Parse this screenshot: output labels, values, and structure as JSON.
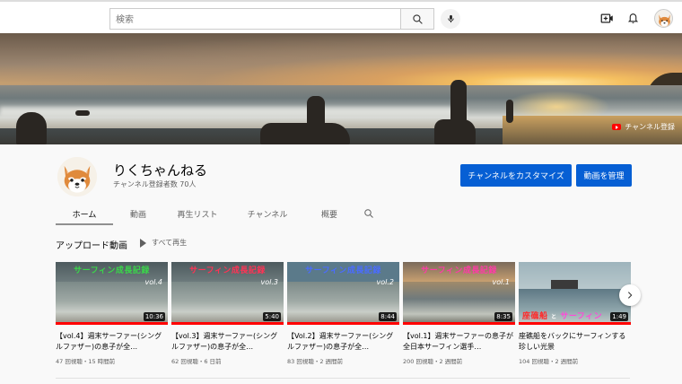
{
  "search": {
    "placeholder": "検索"
  },
  "banner": {
    "subscribe_label": "チャンネル登録"
  },
  "channel": {
    "name": "りくちゃんねる",
    "subscribers": "チャンネル登録者数 70人",
    "customize_label": "チャンネルをカスタマイズ",
    "manage_label": "動画を管理"
  },
  "tabs": [
    {
      "label": "ホーム",
      "active": true
    },
    {
      "label": "動画"
    },
    {
      "label": "再生リスト"
    },
    {
      "label": "チャンネル"
    },
    {
      "label": "概要"
    }
  ],
  "uploads": {
    "title": "アップロード動画",
    "play_all": "すべて再生",
    "videos": [
      {
        "thumb_title": "サーフィン成長記録",
        "thumb_vol": "vol.4",
        "duration": "10:36",
        "title": "【vol.4】週末サーファー(シングルファザー)の息子が全…",
        "meta": "47 回視聴・15 時間前",
        "title_color": "#3ad64a"
      },
      {
        "thumb_title": "サーフィン成長記録",
        "thumb_vol": "vol.3",
        "duration": "5:40",
        "title": "【vol.3】週末サーファー(シングルファザー)の息子が全…",
        "meta": "62 回視聴・6 日前",
        "title_color": "#ff3355"
      },
      {
        "thumb_title": "サーフィン成長記録",
        "thumb_vol": "vol.2",
        "duration": "8:44",
        "title": "【Vol.2】週末サーファー(シングルファザー)の息子が全…",
        "meta": "83 回視聴・2 週間前",
        "title_color": "#4a6cff"
      },
      {
        "thumb_title": "サーフィン成長記録",
        "thumb_vol": "vol.1",
        "duration": "8:35",
        "title": "【vol.1】週末サーファーの息子が全日本サーフィン選手…",
        "meta": "200 回視聴・2 週間前",
        "title_color": "#ff3aa8"
      },
      {
        "thumb_title": "座礁船",
        "thumb_title2": "サーフィン",
        "duration": "1:49",
        "title": "座礁船をバックにサーフィンする珍しい光景",
        "meta": "104 回視聴・2 週間前",
        "title_color": "#ff2a2a"
      }
    ]
  },
  "colors": {
    "accent_blue": "#065fd4",
    "progress_red": "#ff0000"
  },
  "icons": [
    "search-icon",
    "mic-icon",
    "create-video-icon",
    "bell-icon",
    "avatar",
    "play-icon",
    "chevron-right-icon"
  ]
}
